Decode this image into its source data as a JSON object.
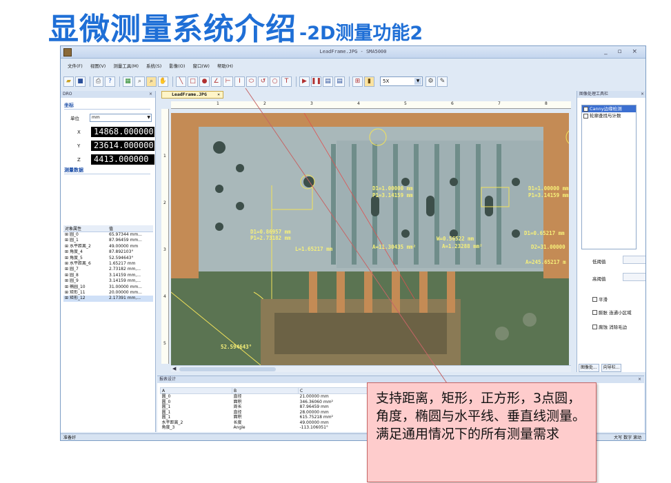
{
  "slide": {
    "title": "显微测量系统介绍",
    "subtitle": "-2D测量功能2"
  },
  "window": {
    "title": "LeadFrame.JPG - SMA5000",
    "controls": "_ ▫ ×"
  },
  "menu": [
    "文件(F)",
    "视图(V)",
    "测量工具(M)",
    "系统(S)",
    "影像(O)",
    "窗口(W)",
    "帮助(H)"
  ],
  "toolbar": {
    "zoom": "5X"
  },
  "left_panel": {
    "header": "DRO",
    "coord_title": "坐标",
    "unit_label": "单位",
    "unit_value": "mm",
    "x_label": "X",
    "x_value": "14868.000000",
    "y_label": "Y",
    "y_value": "23614.000000",
    "z_label": "Z",
    "z_value": "4413.000000",
    "measure_title": "测量数据",
    "col_name": "对象属性",
    "col_value": "值",
    "rows": [
      {
        "name": "圆_0",
        "value": "65.97344 mm..."
      },
      {
        "name": "圆_1",
        "value": "87.96459 mm..."
      },
      {
        "name": "水平距离_2",
        "value": "49.00000 mm"
      },
      {
        "name": "角度_4",
        "value": "87.892103°"
      },
      {
        "name": "角度_5",
        "value": "52.594643°"
      },
      {
        "name": "水平距离_6",
        "value": "1.65217 mm"
      },
      {
        "name": "圆_7",
        "value": "2.73182 mm,..."
      },
      {
        "name": "圆_8",
        "value": "3.14159 mm,..."
      },
      {
        "name": "圆_9",
        "value": "3.14159 mm,..."
      },
      {
        "name": "椭圆_10",
        "value": "31.00000 mm..."
      },
      {
        "name": "矩形_11",
        "value": "20.00000 mm..."
      },
      {
        "name": "矩形_12",
        "value": "2.17391 mm,..."
      }
    ]
  },
  "document": {
    "tab": "LeadFrame.JPG",
    "ruler_h": [
      "1",
      "2",
      "3",
      "4",
      "5",
      "6",
      "7",
      "8"
    ],
    "ruler_v": [
      "1",
      "2",
      "3",
      "4",
      "5"
    ],
    "annotations": {
      "c1": "D1=1.00000 mm",
      "c1b": "P1=3.14159 mm",
      "c2": "D1=1.00000 mm",
      "c2b": "P1=3.14159 mm",
      "c3": "D1=0.86957 mm",
      "c3b": "P1=2.73182 mm",
      "dist": "L=1.65217 mm",
      "area1": "A=11.30435 mm²",
      "rect": "W=0.56522 mm",
      "rectb": "A=1.23288 mm²",
      "ell1": "D1=0.65217 mm",
      "ell2": "D2=31.00000",
      "area2": "A=245.65217 m",
      "angle": "52.594643°"
    }
  },
  "right_panel": {
    "header": "图像处理工具栏",
    "items": [
      "Canny边缘检测",
      "轮廓查找与计数"
    ],
    "low_threshold": "低阈值",
    "high_threshold": "高阈值",
    "smooth": "平滑",
    "dilate": "膨胀 连通小区域",
    "erode": "腐蚀 消除毛边",
    "tab1": "图像处...",
    "tab2": "向导栏..."
  },
  "report": {
    "header": "报表设计",
    "col_a": "A",
    "col_b": "B",
    "col_c": "C",
    "rows": [
      {
        "a": "圆_0",
        "b": "直径",
        "c": "21.00000 mm"
      },
      {
        "a": "圆_0",
        "b": "面积",
        "c": "346.36060 mm²"
      },
      {
        "a": "圆_1",
        "b": "周长",
        "c": "87.96459 mm"
      },
      {
        "a": "圆_1",
        "b": "直径",
        "c": "28.00000 mm"
      },
      {
        "a": "圆_1",
        "b": "面积",
        "c": "615.75218 mm²"
      },
      {
        "a": "水平距离_2",
        "b": "长度",
        "c": "49.00000 mm"
      },
      {
        "a": "角度_3",
        "b": "Angle",
        "c": "-113.106051°"
      }
    ]
  },
  "status": {
    "left": "准备好",
    "right": "大写 数字 滚动"
  },
  "callout": {
    "text": "支持距离，矩形，正方形，3点圆，角度，椭圆与水平线、垂直线测量。满足通用情况下的所有测量需求"
  }
}
